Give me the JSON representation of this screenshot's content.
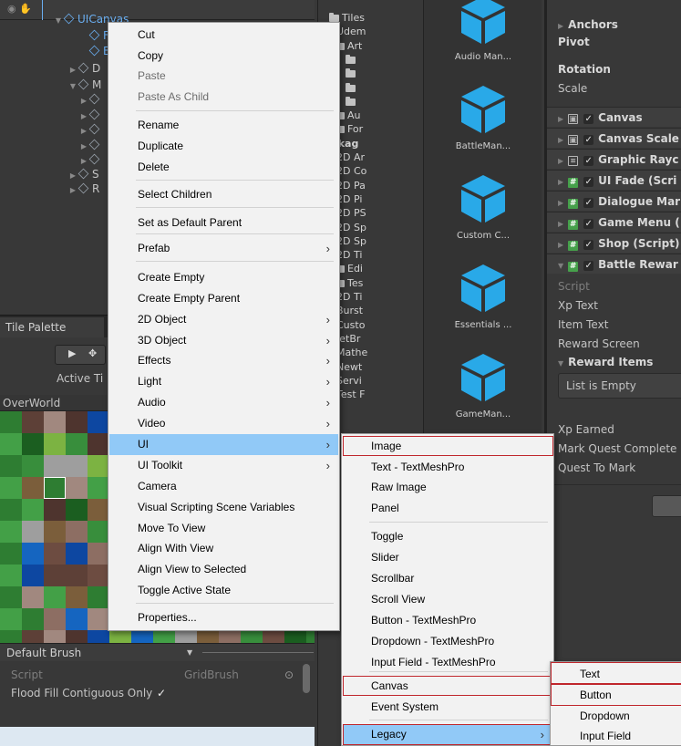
{
  "hierarchy": {
    "root_label": "UICanvas",
    "partial_rows": [
      "Fa",
      "EV",
      "D",
      "M",
      "",
      "",
      "",
      "",
      "",
      "S",
      "R"
    ]
  },
  "project_tree": {
    "items": [
      "Tiles",
      "Udem",
      "Art",
      "",
      "",
      "",
      "",
      "Au",
      "For",
      "Packag",
      "2D Ar",
      "2D Co",
      "2D Pa",
      "2D Pi",
      "2D PS",
      "2D Sp",
      "2D Sp",
      "2D Ti",
      "Edi",
      "Tes",
      "2D Ti",
      "Burst",
      "Custo",
      "JetBr",
      "Mathe",
      "Newt",
      "Servi",
      "Test F"
    ]
  },
  "project_assets": [
    "Audio Man...",
    "BattleMan...",
    "Custom C...",
    "Essentials ...",
    "GameMan..."
  ],
  "inspector": {
    "transform_rows": [
      "Anchors",
      "Pivot",
      "Rotation",
      "Scale"
    ],
    "components": [
      "Canvas",
      "Canvas Scale",
      "Graphic Rayc",
      "UI Fade (Scri",
      "Dialogue Mar",
      "Game Menu (",
      "Shop (Script)",
      "Battle Rewar"
    ],
    "fields": [
      "Script",
      "Xp Text",
      "Item Text",
      "Reward Screen"
    ],
    "reward_items_label": "Reward Items",
    "list_empty": "List is Empty",
    "fields2": [
      "Xp Earned",
      "Mark Quest Complete",
      "Quest To Mark"
    ]
  },
  "tile_palette": {
    "tab_label": "Tile Palette",
    "active_label": "Active Ti",
    "palette_name": "OverWorld",
    "brush_label": "Default Brush",
    "script_label": "Script",
    "script_value": "GridBrush",
    "flood_label": "Flood Fill Contiguous Only",
    "flood_check": "✓"
  },
  "main_menu": {
    "items": [
      {
        "label": "Cut",
        "disabled": false,
        "submenu": false
      },
      {
        "label": "Copy",
        "disabled": false,
        "submenu": false
      },
      {
        "label": "Paste",
        "disabled": true,
        "submenu": false
      },
      {
        "label": "Paste As Child",
        "disabled": true,
        "submenu": false
      },
      {
        "label": "Rename",
        "disabled": false,
        "submenu": false
      },
      {
        "label": "Duplicate",
        "disabled": false,
        "submenu": false
      },
      {
        "label": "Delete",
        "disabled": false,
        "submenu": false
      },
      {
        "label": "Select Children",
        "disabled": false,
        "submenu": false
      },
      {
        "label": "Set as Default Parent",
        "disabled": false,
        "submenu": false
      },
      {
        "label": "Prefab",
        "disabled": false,
        "submenu": true
      },
      {
        "label": "Create Empty",
        "disabled": false,
        "submenu": false
      },
      {
        "label": "Create Empty Parent",
        "disabled": false,
        "submenu": false
      },
      {
        "label": "2D Object",
        "disabled": false,
        "submenu": true
      },
      {
        "label": "3D Object",
        "disabled": false,
        "submenu": true
      },
      {
        "label": "Effects",
        "disabled": false,
        "submenu": true
      },
      {
        "label": "Light",
        "disabled": false,
        "submenu": true
      },
      {
        "label": "Audio",
        "disabled": false,
        "submenu": true
      },
      {
        "label": "Video",
        "disabled": false,
        "submenu": true
      },
      {
        "label": "UI",
        "disabled": false,
        "submenu": true,
        "highlighted": true
      },
      {
        "label": "UI Toolkit",
        "disabled": false,
        "submenu": true
      },
      {
        "label": "Camera",
        "disabled": false,
        "submenu": false
      },
      {
        "label": "Visual Scripting Scene Variables",
        "disabled": false,
        "submenu": false
      },
      {
        "label": "Move To View",
        "disabled": false,
        "submenu": false
      },
      {
        "label": "Align With View",
        "disabled": false,
        "submenu": false
      },
      {
        "label": "Align View to Selected",
        "disabled": false,
        "submenu": false
      },
      {
        "label": "Toggle Active State",
        "disabled": false,
        "submenu": false
      },
      {
        "label": "Properties...",
        "disabled": false,
        "submenu": false
      }
    ],
    "arrow_glyph": "›"
  },
  "ui_menu": {
    "items": [
      {
        "label": "Image",
        "boxed": true
      },
      {
        "label": "Text - TextMeshPro"
      },
      {
        "label": "Raw Image"
      },
      {
        "label": "Panel"
      },
      {
        "label": "Toggle"
      },
      {
        "label": "Slider"
      },
      {
        "label": "Scrollbar"
      },
      {
        "label": "Scroll View"
      },
      {
        "label": "Button - TextMeshPro"
      },
      {
        "label": "Dropdown - TextMeshPro"
      },
      {
        "label": "Input Field - TextMeshPro"
      },
      {
        "label": "Canvas",
        "boxed": true
      },
      {
        "label": "Event System"
      },
      {
        "label": "Legacy",
        "submenu": true,
        "highlighted": true
      }
    ]
  },
  "legacy_menu": {
    "items": [
      {
        "label": "Text"
      },
      {
        "label": "Button",
        "boxed": true
      },
      {
        "label": "Dropdown"
      },
      {
        "label": "Input Field"
      }
    ]
  },
  "colors": {
    "highlight": "#91c9f7",
    "red_box": "#c0272d",
    "unity_dark": "#383838",
    "asset_blue": "#29a9e8"
  }
}
